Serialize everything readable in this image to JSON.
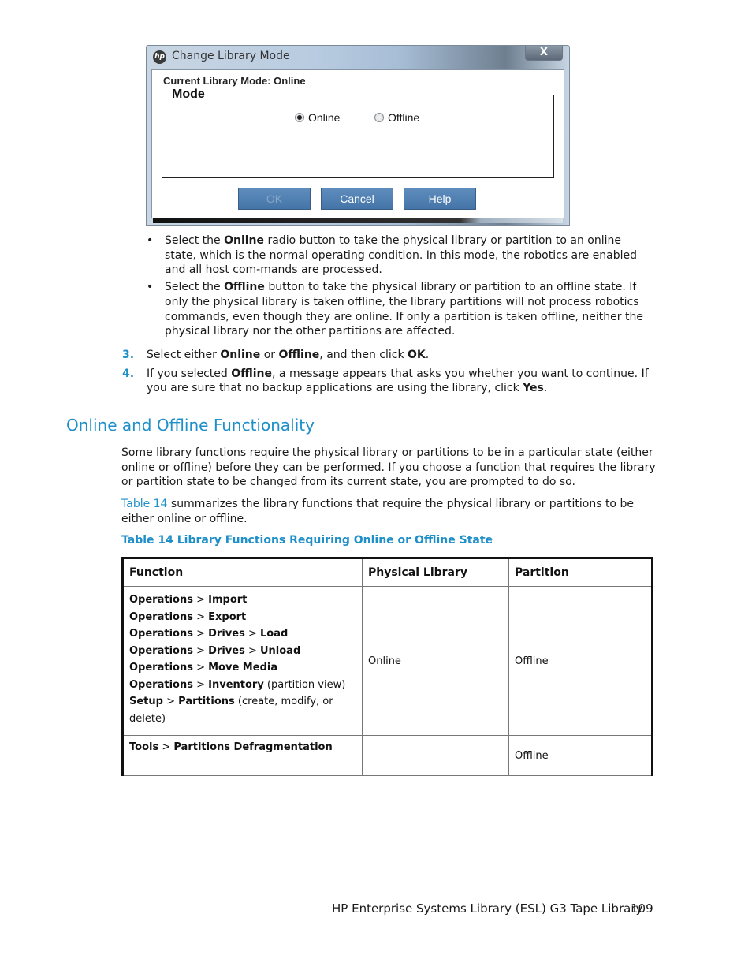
{
  "dialog": {
    "title": "Change Library Mode",
    "close_label": "X",
    "current_mode_label": "Current Library Mode:  Online",
    "mode_group_label": "Mode",
    "radios": [
      {
        "label": "Online",
        "checked": true
      },
      {
        "label": "Offline",
        "checked": false
      }
    ],
    "buttons": {
      "ok": "OK",
      "cancel": "Cancel",
      "help": "Help"
    },
    "logo_text": "hp"
  },
  "bullets": [
    {
      "pre": "Select the ",
      "bold": "Online",
      "post": " radio button to take the physical library or partition to an online state, which is the normal operating condition. In this mode, the robotics are enabled and all host com-mands are processed."
    },
    {
      "pre": "Select the ",
      "bold": "Offline",
      "post": " button to take the physical library or partition to an offline state. If only the physical library is taken offline, the library partitions will not process robotics commands, even though they are online. If only a partition is taken offline, neither the physical library nor the other partitions are affected."
    }
  ],
  "bullet_symbol": "•",
  "steps": [
    {
      "num": "3.",
      "parts": [
        "Select either ",
        "Online",
        " or ",
        "Offline",
        ", and then click ",
        "OK",
        "."
      ]
    },
    {
      "num": "4.",
      "parts": [
        "If you selected ",
        "Offline",
        ", a message appears that asks you whether you want to continue. If you are sure that no backup applications are using the library, click ",
        "Yes",
        "."
      ]
    }
  ],
  "section": {
    "title": "Online and Offline Functionality",
    "para1": "Some library functions require the physical library or partitions to be in a particular state (either online or offline) before they can be performed. If you choose a function that requires the library or partition state to be changed from its current state, you are prompted to do so.",
    "para2_link": "Table 14",
    "para2_rest": " summarizes the library functions that require the physical library or partitions to be either online or offline.",
    "table_caption": "Table 14 Library Functions Requiring Online or Offline State"
  },
  "table": {
    "headers": [
      "Function",
      "Physical Library",
      "Partition"
    ],
    "rows": [
      {
        "functions": [
          {
            "bold": "Operations",
            "sep": " > ",
            "bold2": "Import",
            "note": ""
          },
          {
            "bold": "Operations",
            "sep": " > ",
            "bold2": "Export",
            "note": ""
          },
          {
            "bold": "Operations",
            "sep": " > ",
            "bold2": "Drives",
            "sep2": " > ",
            "bold3": "Load",
            "note": ""
          },
          {
            "bold": "Operations",
            "sep": " > ",
            "bold2": "Drives",
            "sep2": " > ",
            "bold3": "Unload",
            "note": ""
          },
          {
            "bold": "Operations",
            "sep": " > ",
            "bold2": "Move Media",
            "note": ""
          },
          {
            "bold": "Operations",
            "sep": " > ",
            "bold2": "Inventory",
            "note": " (partition view)"
          },
          {
            "bold": "Setup",
            "sep": " > ",
            "bold2": "Partitions",
            "note": " (create, modify, or delete)"
          }
        ],
        "physical_library": "Online",
        "partition": "Offline"
      },
      {
        "functions": [
          {
            "bold": "Tools",
            "sep": " > ",
            "bold2": "Partitions Defragmentation",
            "note": ""
          }
        ],
        "physical_library": "—",
        "partition": "Offline"
      }
    ]
  },
  "footer": {
    "title": "HP Enterprise Systems Library (ESL) G3 Tape Library",
    "page_number": "109"
  }
}
